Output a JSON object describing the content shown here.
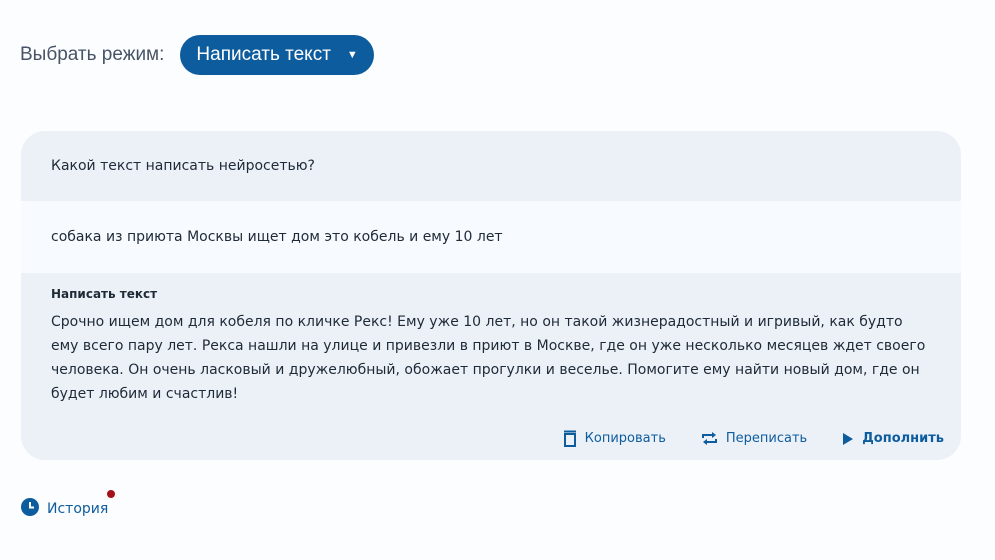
{
  "mode": {
    "label": "Выбрать режим:",
    "selected": "Написать текст"
  },
  "prompt": {
    "question": "Какой текст написать нейросетью?",
    "input_value": "собака из приюта Москвы ищет дом это кобель и ему 10 лет"
  },
  "result": {
    "title": "Написать текст",
    "text": "Срочно ищем дом для кобеля по кличке Рекс! Ему уже 10 лет, но он такой жизнерадостный и игривый, как будто ему всего пару лет. Рекса нашли на улице и привезли в приют в Москве, где он уже несколько месяцев ждет своего человека. Он очень ласковый и дружелюбный, обожает прогулки и веселье. Помогите ему найти новый дом, где он будет любим и счастлив!"
  },
  "actions": {
    "copy": "Копировать",
    "rewrite": "Переписать",
    "continue": "Дополнить"
  },
  "history": {
    "label": "История"
  },
  "icons": {
    "copy": "copy-icon",
    "rewrite": "repeat-icon",
    "continue": "play-icon",
    "history": "clock-icon",
    "caret": "caret-down-icon"
  },
  "colors": {
    "accent": "#0d5c9e",
    "card_bg": "#ecf1f8",
    "input_bg": "#f7faff",
    "notification": "#a50f1a"
  }
}
